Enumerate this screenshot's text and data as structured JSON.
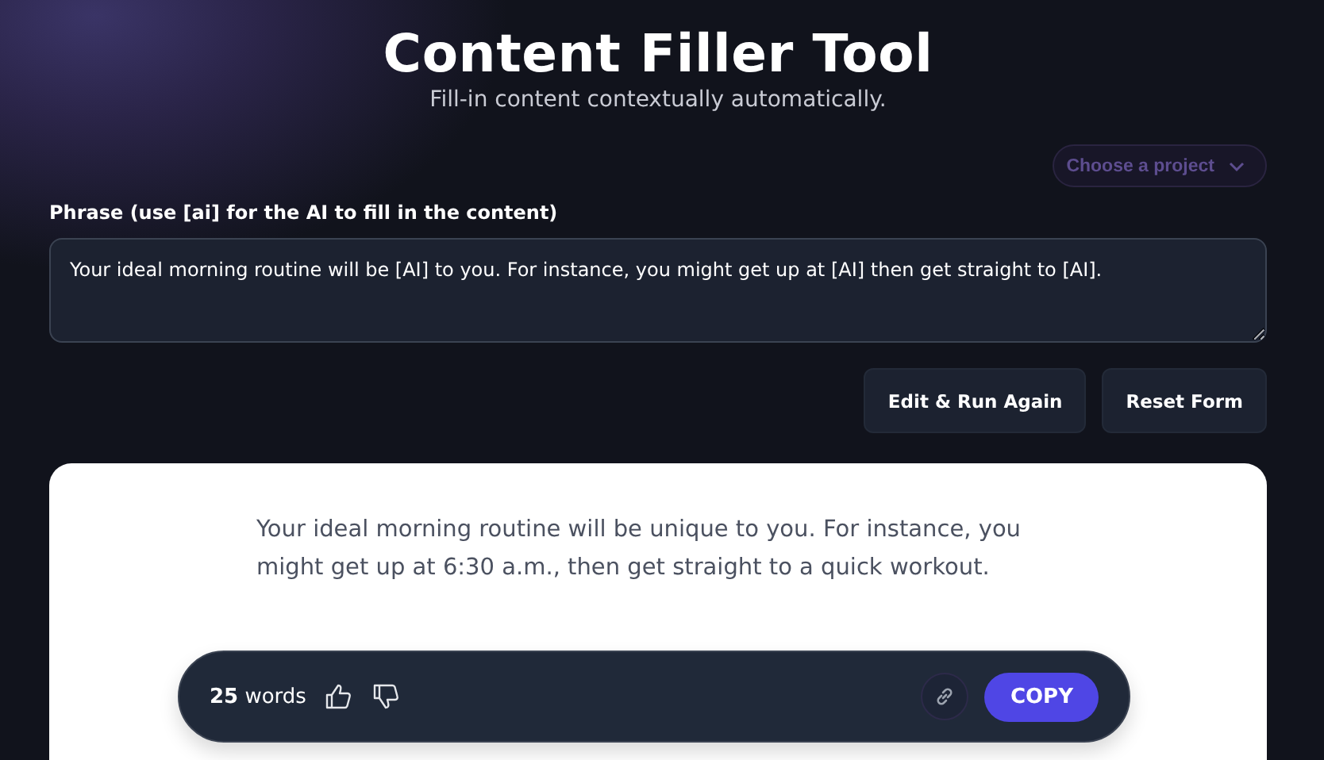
{
  "header": {
    "title": "Content Filler Tool",
    "subtitle": "Fill-in content contextually automatically."
  },
  "project_select": {
    "placeholder": "Choose a project"
  },
  "phrase": {
    "label": "Phrase (use [ai] for the AI to fill in the content)",
    "value": "Your ideal morning routine will be [AI] to you. For instance, you might get up at [AI] then get straight to [AI]."
  },
  "buttons": [
    "Edit & Run Again",
    "Reset Form"
  ],
  "result": {
    "text": "Your ideal morning routine will be unique to you. For instance, you might get up at 6:30 a.m., then get straight to a quick workout.",
    "word_count": "**25** words",
    "copy_label": "COPY"
  }
}
